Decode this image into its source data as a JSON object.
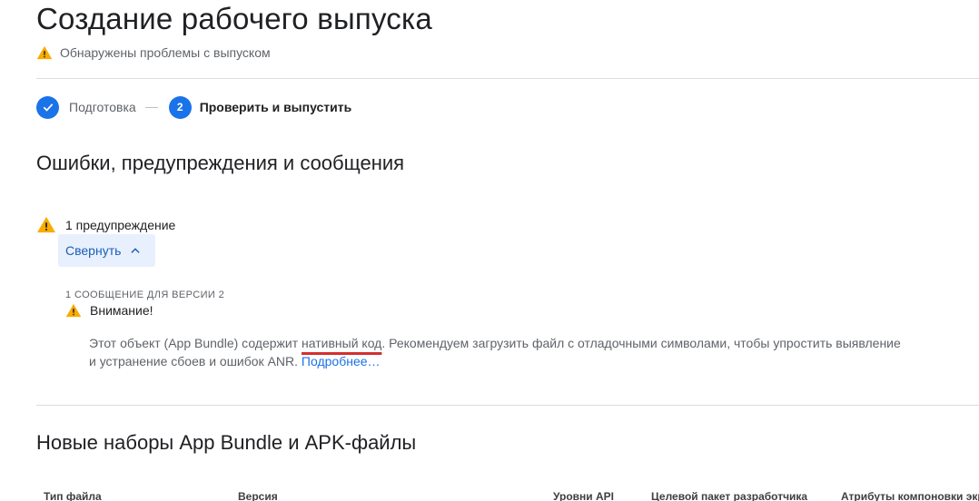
{
  "page": {
    "title": "Создание рабочего выпуска",
    "status": "Обнаружены проблемы с выпуском"
  },
  "stepper": {
    "steps": [
      {
        "number": "✓",
        "label": "Подготовка",
        "state": "done"
      },
      {
        "number": "2",
        "label": "Проверить и выпустить",
        "state": "active"
      }
    ]
  },
  "errors_section": {
    "heading": "Ошибки, предупреждения и сообщения",
    "warning_count": "1 предупреждение",
    "collapse_label": "Свернуть",
    "message_group": "1 СООБЩЕНИЕ ДЛЯ ВЕРСИИ 2",
    "message": {
      "title": "Внимание!",
      "text_before": "Этот объект (App Bundle) содержит ",
      "text_underlined": "нативный код",
      "text_after": ". Рекомендуем загрузить файл с отладочными символами, чтобы упростить выявление и устранение сбоев и ошибок ANR. ",
      "link": "Подробнее…"
    }
  },
  "bundles_section": {
    "heading": "Новые наборы App Bundle и APK-файлы",
    "columns": [
      "Тип файла",
      "Версия",
      "Уровни API",
      "Целевой пакет разработчика",
      "Атрибуты компоновки экр"
    ]
  },
  "colors": {
    "accent": "#1a73e8",
    "warning": "#f9ab00",
    "underline": "#d32f2f",
    "collapse_bg": "#e8f0fe"
  },
  "icons": {
    "status": "warning-triangle-icon",
    "step_done": "checkmark-icon",
    "collapse": "chevron-up-icon"
  }
}
